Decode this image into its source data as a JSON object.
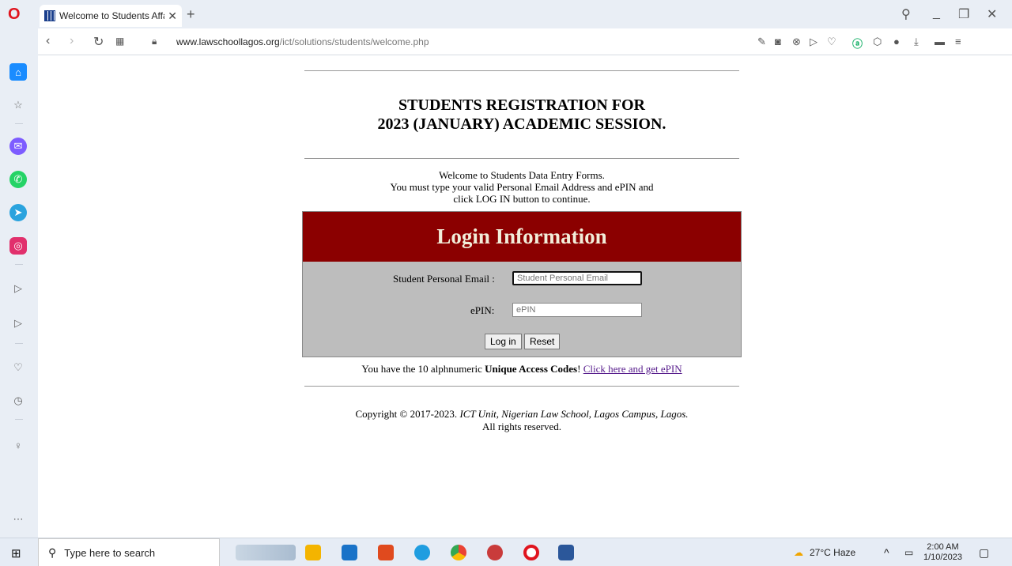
{
  "browser": {
    "tab_title": "Welcome to Students Affai",
    "url_host": "www.lawschoollagos.org",
    "url_path": "/ict/solutions/students/welcome.php"
  },
  "page": {
    "title_line1": "STUDENTS REGISTRATION FOR",
    "title_line2": "2023 (JANUARY) ACADEMIC SESSION.",
    "welcome_line1": "Welcome to Students Data Entry Forms.",
    "welcome_line2": "You must type your valid Personal Email Address and ePIN and",
    "welcome_line3": "click LOG IN button to continue.",
    "login_heading": "Login Information",
    "email_label": "Student Personal Email :",
    "email_placeholder": "Student Personal Email",
    "epin_label": "ePIN:",
    "epin_placeholder": "ePIN",
    "login_button": "Log in",
    "reset_button": "Reset",
    "access_prefix": "You have the 10 alphnumeric ",
    "access_bold": "Unique Access Codes",
    "access_suffix": "! ",
    "access_link": "Click here and get ePIN",
    "copyright_prefix": "Copyright © 2017-2023. ",
    "copyright_italic": "ICT Unit, Nigerian Law School, Lagos Campus, Lagos.",
    "copyright_line2": "All rights reserved."
  },
  "taskbar": {
    "search_placeholder": "Type here to search",
    "weather": "27°C  Haze",
    "time": "2:00 AM",
    "date": "1/10/2023"
  },
  "colors": {
    "login_header_bg": "#8b0000",
    "login_body_bg": "#bdbdbd",
    "opera_red": "#e0141e"
  }
}
